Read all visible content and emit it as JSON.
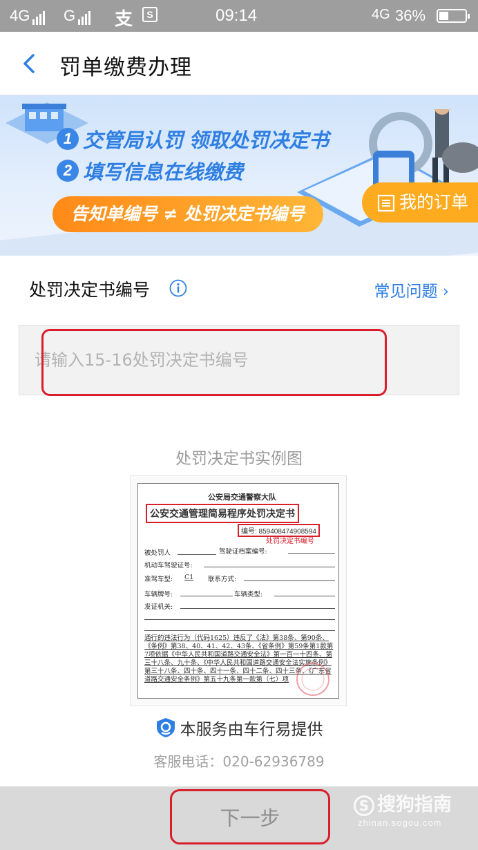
{
  "status_bar": {
    "network_left": "4G",
    "network_mid": "G",
    "app_icon_1": "支",
    "app_icon_2": "S",
    "time": "09:14",
    "network_right": "4G",
    "battery_text": "36%",
    "battery_level": 0.36
  },
  "nav": {
    "title": "罚单缴费办理"
  },
  "banner": {
    "step1_num": "1",
    "step1_text": "交管局认罚 领取处罚决定书",
    "step2_num": "2",
    "step2_text": "填写信息在线缴费",
    "notice": "告知单编号 ≠ 处罚决定书编号",
    "orders_label": "我的订单"
  },
  "form": {
    "field_label": "处罚决定书编号",
    "faq_label": "常见问题 ›",
    "input_value": "",
    "input_placeholder": "请输入15-16处罚决定书编号"
  },
  "example": {
    "title": "处罚决定书实例图",
    "doc": {
      "agency": "公安局交通警察大队",
      "heading": "公安交通管理简易程序处罚决定书",
      "number_line": "编号: 859408474908594",
      "number_note": "处罚决定书编号",
      "row1a": "被处罚人",
      "row1b": "驾驶证档案编号:",
      "row2": "机动车驾驶证号:",
      "row3a": "准驾车型:",
      "row3b": "C1",
      "row3c": "联系方式:",
      "row4a": "车辆牌号:",
      "row4b": "车辆类型:",
      "row5": "发证机关:",
      "body": "通行的违法行为（代码1625）违反了《法》第38条、第90条、《条例》第38、40、41、42、43条、《省条例》第59条第1款第7项依据《中华人民共和国道路交通安全法》第一百一十四条、第三十八条、九十条、《中华人民共和国道路交通安全法实施条例》第三十八条、四十条、四十一条、四十二条、四十三条、《广东省道路交通安全条例》第五十九条第一款第（七）项"
    }
  },
  "provider": {
    "text": "本服务由车行易提供",
    "hotline": "客服电话：020-62936789"
  },
  "bottom": {
    "next_label": "下一步"
  },
  "watermark": {
    "brand": "搜狗指南",
    "brand_mark": "S",
    "url": "zhinan.sogou.com"
  },
  "colors": {
    "accent_blue": "#2f7fe3",
    "orange": "#ffab1f",
    "highlight_red": "#d81e2b"
  }
}
